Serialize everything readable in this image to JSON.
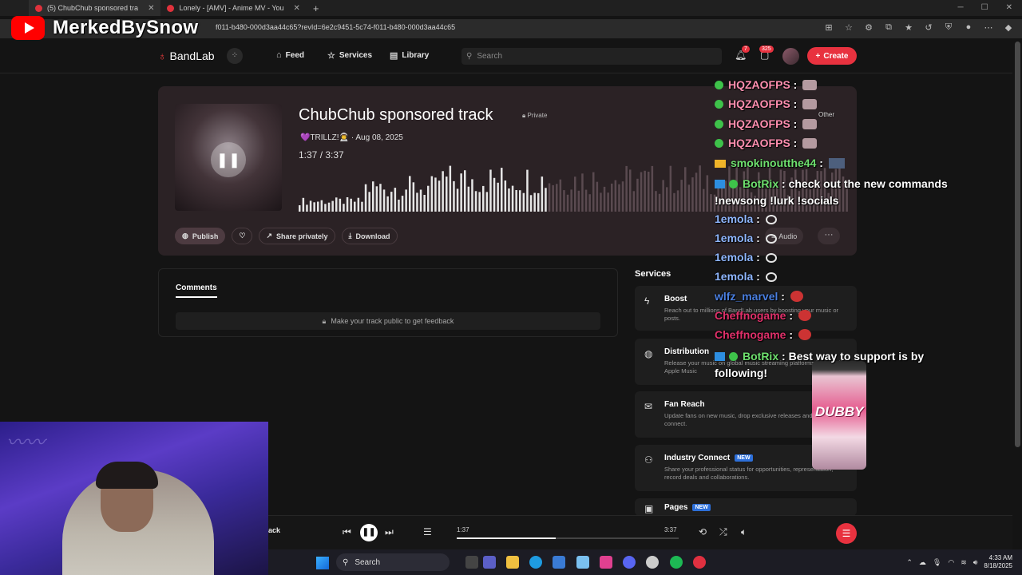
{
  "browser": {
    "tabs": [
      {
        "label": "(5) ChubChub sponsored tra",
        "active": true
      },
      {
        "label": "Lonely - [AMV] - Anime MV - You",
        "active": false
      }
    ],
    "new_tab": "+",
    "url": "f011-b480-000d3aa44c65?revId=6e2c9451-5c74-f011-b480-000d3aa44c65"
  },
  "overlay": {
    "channel_name": "MerkedBySnow"
  },
  "nav": {
    "logo": "BandLab",
    "links": [
      "Feed",
      "Services",
      "Library"
    ],
    "search_placeholder": "Search",
    "notifications_count": "7",
    "messages_count": "325",
    "create_label": "Create"
  },
  "track": {
    "title": "ChubChub sponsored track",
    "privacy": "Private",
    "artist": "💜TRILLZ!👨‍🚀",
    "date": "· Aug 08, 2025",
    "time_current": "1:37",
    "time_total": "/  3:37",
    "progress": 0.447,
    "actions": {
      "publish": "Publish",
      "share": "Share privately",
      "download": "Download",
      "audio": "Audio"
    }
  },
  "comments": {
    "title": "Comments",
    "empty": "Make your track public to get feedback"
  },
  "services": {
    "heading": "Services",
    "items": [
      {
        "title": "Boost",
        "desc": "Reach out to millions of BandLab users by boosting your music or posts.",
        "new": ""
      },
      {
        "title": "Distribution",
        "desc": "Release your music on global music streaming platforms like Spotify, Apple Music",
        "new": ""
      },
      {
        "title": "Fan Reach",
        "desc": "Update fans on new music, drop exclusive releases and reach out to connect.",
        "new": ""
      },
      {
        "title": "Industry Connect",
        "desc": "Share your professional status for opportunities, representation, record deals and collaborations.",
        "new": "NEW"
      },
      {
        "title": "Pages",
        "desc": "",
        "new": "NEW"
      }
    ]
  },
  "chat": [
    {
      "user": "HQZAOFPS",
      "text": "",
      "color": "#ff8fb0"
    },
    {
      "user": "HQZAOFPS",
      "text": "",
      "color": "#ff8fb0"
    },
    {
      "user": "HQZAOFPS",
      "text": "",
      "color": "#ff8fb0"
    },
    {
      "user": "HQZAOFPS",
      "text": "",
      "color": "#ff8fb0"
    },
    {
      "user": "smokinoutthe44",
      "text": "",
      "color": "#6ee06e"
    },
    {
      "user": "BotRix",
      "text": "check out the new commands !newsong !lurk !socials",
      "color": "#6ee06e"
    },
    {
      "user": "1emola",
      "text": "",
      "color": "#8fb7ff"
    },
    {
      "user": "1emola",
      "text": "",
      "color": "#8fb7ff"
    },
    {
      "user": "1emola",
      "text": "",
      "color": "#8fb7ff"
    },
    {
      "user": "1emola",
      "text": "",
      "color": "#8fb7ff"
    },
    {
      "user": "wlfz_marvel",
      "text": "",
      "color": "#4a7fe0"
    },
    {
      "user": "Cheffnogame",
      "text": "",
      "color": "#e0306a"
    },
    {
      "user": "Cheffnogame",
      "text": "",
      "color": "#e0306a"
    },
    {
      "user": "BotRix",
      "text": "Best way to support is by following!",
      "color": "#6ee06e"
    }
  ],
  "chat_extra": {
    "other_label": "Other"
  },
  "sponsor": {
    "brand": "DUBBY"
  },
  "player": {
    "title_fragment": "ack",
    "current": "1:37",
    "total": "3:37",
    "progress": 0.447
  },
  "taskbar": {
    "search_label": "Search",
    "time": "4:33 AM",
    "date": "8/18/2025"
  }
}
